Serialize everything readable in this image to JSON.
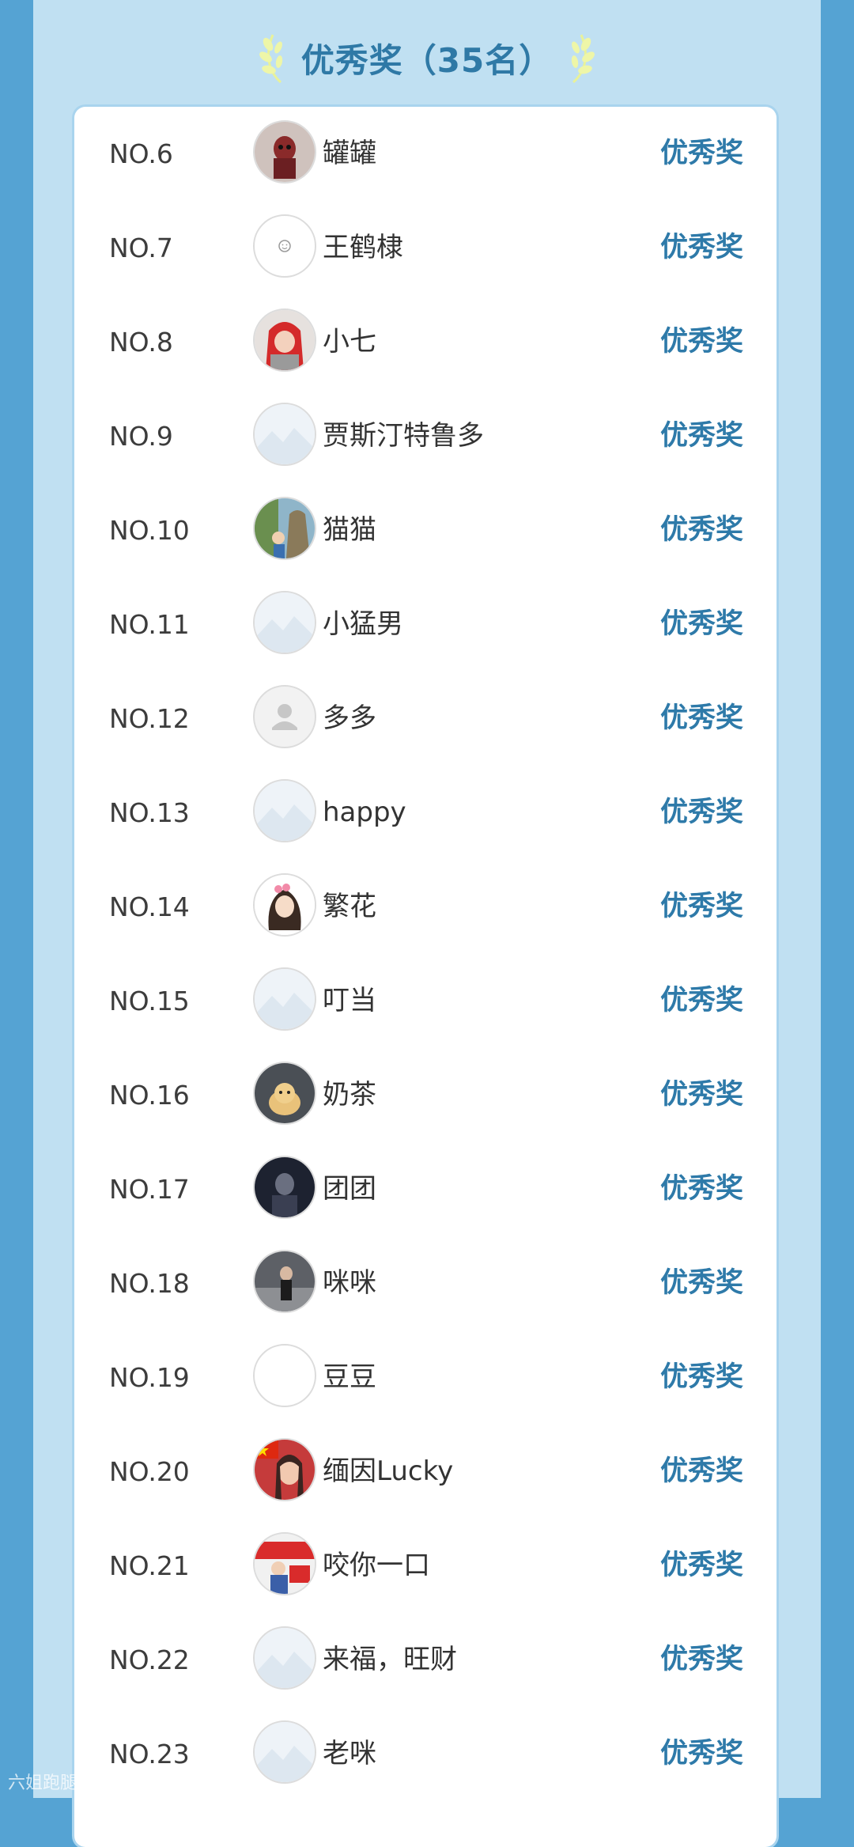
{
  "header": {
    "title": "优秀奖（35名）"
  },
  "award_label": "优秀奖",
  "winners": [
    {
      "rank": "NO.6",
      "name": "罐罐",
      "avatar": "costume-photo"
    },
    {
      "rank": "NO.7",
      "name": "王鹤棣",
      "avatar": "smiley"
    },
    {
      "rank": "NO.8",
      "name": "小七",
      "avatar": "red-hood-child"
    },
    {
      "rank": "NO.9",
      "name": "贾斯汀特鲁多",
      "avatar": "default-landscape"
    },
    {
      "rank": "NO.10",
      "name": "猫猫",
      "avatar": "outdoor-photo"
    },
    {
      "rank": "NO.11",
      "name": "小猛男",
      "avatar": "default-landscape"
    },
    {
      "rank": "NO.12",
      "name": "多多",
      "avatar": "default-person"
    },
    {
      "rank": "NO.13",
      "name": "happy",
      "avatar": "default-landscape"
    },
    {
      "rank": "NO.14",
      "name": "繁花",
      "avatar": "cartoon-girl"
    },
    {
      "rank": "NO.15",
      "name": "叮当",
      "avatar": "default-landscape"
    },
    {
      "rank": "NO.16",
      "name": "奶茶",
      "avatar": "cat-photo"
    },
    {
      "rank": "NO.17",
      "name": "团团",
      "avatar": "dark-photo"
    },
    {
      "rank": "NO.18",
      "name": "咪咪",
      "avatar": "street-photo"
    },
    {
      "rank": "NO.19",
      "name": "豆豆",
      "avatar": "blank"
    },
    {
      "rank": "NO.20",
      "name": "缅因Lucky",
      "avatar": "flag-photo"
    },
    {
      "rank": "NO.21",
      "name": "咬你一口",
      "avatar": "red-banner-photo"
    },
    {
      "rank": "NO.22",
      "name": "来福，旺财",
      "avatar": "default-landscape"
    },
    {
      "rank": "NO.23",
      "name": "老咪",
      "avatar": "default-landscape"
    }
  ],
  "watermark": "六姐跑腿",
  "colors": {
    "accent": "#2e7aa9",
    "page_bg": "#55a3d3",
    "panel_bg": "#c0e0f2",
    "card_bg": "#ffffff"
  }
}
